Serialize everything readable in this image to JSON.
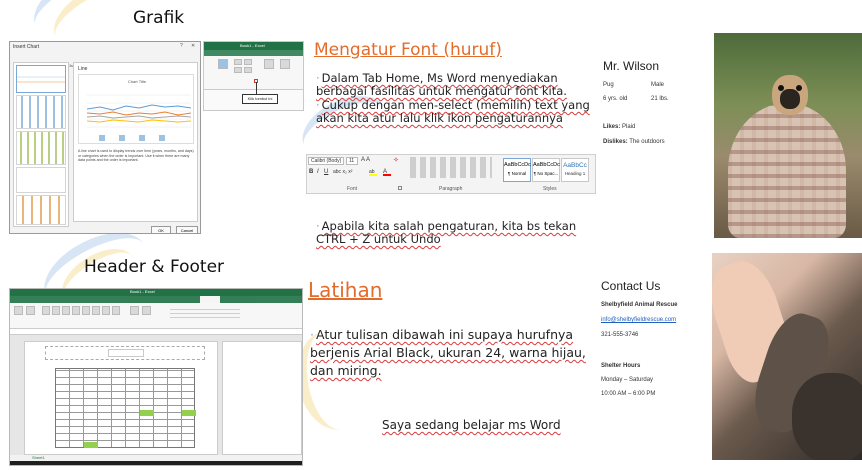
{
  "headings": {
    "grafik": "Grafik",
    "header_footer": "Header & Footer"
  },
  "chart_dialog": {
    "title": "Insert Chart",
    "tabs": [
      "Recommended Charts",
      "All Charts"
    ],
    "chart_type": "Line",
    "preview_title": "Chart Title",
    "description": "A line chart is used to display trends over time (years, months, and days) or categories when the order is important. Use it when there are many data points and the order is important.",
    "ok": "OK",
    "cancel": "Cancel"
  },
  "excel_top": {
    "title": "Book1 - Excel",
    "callout": "Klik tombol ini",
    "tabs": [
      "File",
      "Home",
      "Insert",
      "Page Layout",
      "Formulas",
      "Data"
    ]
  },
  "font_slide": {
    "title": "Mengatur Font (huruf)",
    "bullet1": "Dalam Tab Home, Ms Word menyediakan berbagai fasilitas untuk mengatur font kita.",
    "bullet2": "Cukup dengan men-select (memilih) text yang akan kita atur lalu klik ikon pengaturannya",
    "bullet3": "Apabila kita salah pengaturan, kita bs tekan CTRL + Z untuk Undo",
    "ribbon": {
      "font_name": "Calibri (Body)",
      "font_size": "11",
      "group_font": "Font",
      "group_paragraph": "Paragraph",
      "group_styles": "Styles",
      "styles": [
        {
          "sample": "AaBbCcDc",
          "name": "¶ Normal"
        },
        {
          "sample": "AaBbCcDc",
          "name": "¶ No Spac..."
        },
        {
          "sample": "AaBbCc",
          "name": "Heading 1"
        }
      ]
    }
  },
  "latihan_slide": {
    "title": "Latihan",
    "bullet": "Atur tulisan dibawah ini supaya hurufnya berjenis Arial Black, ukuran 24, warna hijau, dan miring.",
    "sample_text": "Saya sedang belajar ms Word"
  },
  "profile": {
    "name": "Mr. Wilson",
    "breed": "Pug",
    "sex": "Male",
    "age": "6 yrs. old",
    "weight": "21 lbs.",
    "likes_label": "Likes:",
    "likes_value": "Plaid",
    "dislikes_label": "Dislikes:",
    "dislikes_value": "The outdoors"
  },
  "contact": {
    "title": "Contact Us",
    "org": "Shelbyfield Animal Rescue",
    "email": "info@shelbyfieldrescue.com",
    "phone": "321-555-3746",
    "hours_label": "Shelter Hours",
    "hours_days": "Monday – Saturday",
    "hours_time": "10:00 AM – 6:00 PM"
  },
  "excel_bottom": {
    "title": "Book1 - Excel",
    "sheet_tab": "Sheet1",
    "tabs": [
      "File",
      "Home",
      "Insert",
      "Page Layout",
      "Formulas",
      "Data",
      "Review",
      "View",
      "Design"
    ]
  },
  "colors": {
    "accent_orange": "#e36c2b",
    "excel_green": "#217346",
    "swoosh_blue": "#8fb6e0",
    "swoosh_yellow": "#f3cf6b"
  }
}
